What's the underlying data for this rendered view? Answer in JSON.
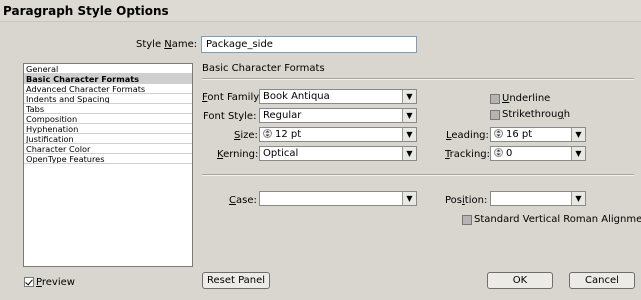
{
  "window": {
    "title": "Paragraph Style Options"
  },
  "style_name": {
    "label": "Style Name:",
    "value": "Package_side"
  },
  "categories": [
    "General",
    "Basic Character Formats",
    "Advanced Character Formats",
    "Indents and Spacing",
    "Tabs",
    "Composition",
    "Hyphenation",
    "Justification",
    "Character Color",
    "OpenType Features"
  ],
  "selected_category": "Basic Character Formats",
  "panel": {
    "title": "Basic Character Formats",
    "font_family": {
      "label": "Font Family:",
      "value": "Book Antiqua"
    },
    "font_style": {
      "label": "Font Style:",
      "value": "Regular"
    },
    "size": {
      "label": "Size:",
      "value": "12 pt"
    },
    "leading": {
      "label": "Leading:",
      "value": "16 pt"
    },
    "kerning": {
      "label": "Kerning:",
      "value": "Optical"
    },
    "tracking": {
      "label": "Tracking:",
      "value": "0"
    },
    "underline": {
      "label": "Underline",
      "checked": false
    },
    "strikethrough": {
      "label": "Strikethrough",
      "checked": false
    },
    "case": {
      "label": "Case:",
      "value": ""
    },
    "position": {
      "label": "Position:",
      "value": ""
    },
    "vertical_roman": {
      "label": "Standard Vertical Roman Alignment",
      "checked": false
    }
  },
  "footer": {
    "preview": {
      "label": "Preview",
      "checked": true
    },
    "reset_label": "Reset Panel",
    "ok_label": "OK",
    "cancel_label": "Cancel"
  }
}
